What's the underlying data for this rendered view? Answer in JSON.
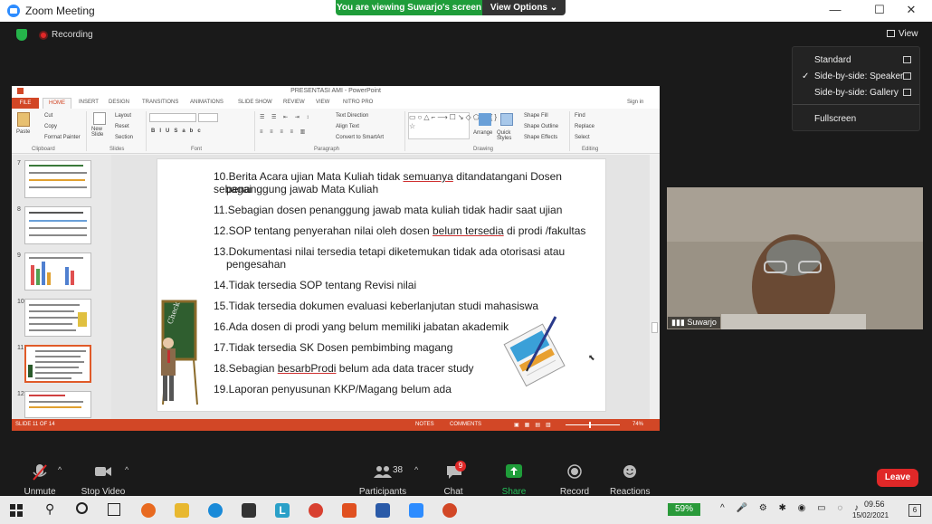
{
  "window": {
    "title": "Zoom Meeting",
    "viewing_banner": "You are viewing Suwarjo's screen",
    "view_options": "View Options",
    "minimize": "—",
    "maximize": "☐",
    "close": "✕"
  },
  "meeting": {
    "recording": "Recording",
    "view_button": "View"
  },
  "view_menu": {
    "items": [
      "Standard",
      "Side-by-side: Speaker",
      "Side-by-side: Gallery"
    ],
    "selected": "Side-by-side: Speaker",
    "fullscreen": "Fullscreen",
    "check": "✓"
  },
  "ppt": {
    "title": "PRESENTASI AMI - PowerPoint",
    "sign_in": "Sign in",
    "tabs": [
      "FILE",
      "HOME",
      "INSERT",
      "DESIGN",
      "TRANSITIONS",
      "ANIMATIONS",
      "SLIDE SHOW",
      "REVIEW",
      "VIEW",
      "NITRO PRO"
    ],
    "ribbon": {
      "paste": "Paste",
      "cut": "Cut",
      "copy": "Copy",
      "format_painter": "Format Painter",
      "clipboard": "Clipboard",
      "new_slide": "New Slide",
      "layout": "Layout",
      "reset": "Reset",
      "section": "Section",
      "slides": "Slides",
      "font": "Font",
      "paragraph": "Paragraph",
      "text_direction": "Text Direction",
      "align_text": "Align Text",
      "convert_smartart": "Convert to SmartArt",
      "arrange": "Arrange",
      "quick_styles": "Quick Styles",
      "shape_fill": "Shape Fill",
      "shape_outline": "Shape Outline",
      "shape_effects": "Shape Effects",
      "drawing": "Drawing",
      "find": "Find",
      "replace": "Replace",
      "select": "Select",
      "editing": "Editing"
    },
    "thumbnails": [
      "7",
      "8",
      "9",
      "10",
      "11",
      "12"
    ],
    "selected_thumb": "11",
    "slide_lines": [
      {
        "text_before": "10.Berita Acara ujian Mata Kuliah tidak ",
        "underlined": "semuanya",
        "text_after": " ditandatangani Dosen sebagai"
      },
      {
        "text_before": "penanggung jawab Mata Kuliah",
        "underlined": "",
        "text_after": ""
      },
      {
        "text_before": "11.Sebagian dosen penanggung jawab mata kuliah tidak hadir saat ujian",
        "underlined": "",
        "text_after": ""
      },
      {
        "text_before": "12.SOP tentang penyerahan nilai oleh dosen ",
        "underlined": "belum tersedia",
        "text_after": " di prodi /fakultas"
      },
      {
        "text_before": "13.Dokumentasi nilai tersedia tetapi diketemukan tidak ada otorisasi atau",
        "underlined": "",
        "text_after": ""
      },
      {
        "text_before": "pengesahan",
        "underlined": "",
        "text_after": ""
      },
      {
        "text_before": "14.Tidak tersedia SOP tentang Revisi nilai",
        "underlined": "",
        "text_after": ""
      },
      {
        "text_before": "15.Tidak tersedia dokumen  evaluasi keberlanjutan studi mahasiswa",
        "underlined": "",
        "text_after": ""
      },
      {
        "text_before": "16.Ada dosen di prodi yang belum memiliki jabatan akademik",
        "underlined": "",
        "text_after": ""
      },
      {
        "text_before": "17.Tidak tersedia SK Dosen pembimbing magang",
        "underlined": "",
        "text_after": ""
      },
      {
        "text_before": "18.Sebagian ",
        "underlined": "besarbProdi",
        "text_after": " belum ada data tracer study"
      },
      {
        "text_before": "19.Laporan penyusunan KKP/Magang belum ada",
        "underlined": "",
        "text_after": ""
      }
    ],
    "status": {
      "slide": "SLIDE 11 OF 14",
      "notes": "NOTES",
      "comments": "COMMENTS",
      "zoom": "74%"
    }
  },
  "participant": {
    "name": "Suwarjo"
  },
  "toolbar": {
    "unmute": "Unmute",
    "stop_video": "Stop Video",
    "participants": "Participants",
    "participants_count": "38",
    "chat": "Chat",
    "chat_badge": "9",
    "share_screen": "Share Screen",
    "record": "Record",
    "reactions": "Reactions",
    "leave": "Leave"
  },
  "taskbar": {
    "battery": "59%",
    "time": "09.56",
    "date": "15/02/2021",
    "notif_count": "6"
  },
  "colors": {
    "zoom_blue": "#2d8cff",
    "green_banner": "#1f9d3a",
    "ppt_red": "#d24726",
    "leave_red": "#e02828"
  }
}
